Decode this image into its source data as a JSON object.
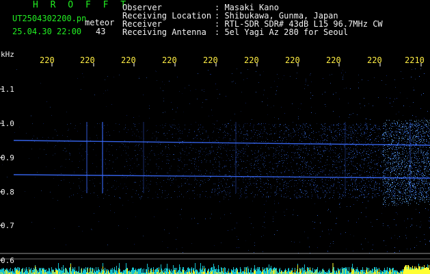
{
  "header": {
    "brand": "H R O F F T",
    "filename": "UT2504302200.pn",
    "mode": "meteor",
    "datetime": "25.04.30 22:00",
    "count": "43",
    "fields": [
      {
        "label": "Observer",
        "value": ": Masaki Kano"
      },
      {
        "label": "Receiving Location",
        "value": ": Shibukawa, Gunma, Japan"
      },
      {
        "label": "Receiver",
        "value": ": RTL-SDR SDR# 43dB L15 96.7MHz CW"
      },
      {
        "label": "Receiving Antenna",
        "value": ": 5el Yagi Az 280 for Seoul"
      }
    ]
  },
  "axis": {
    "y_unit": "kHz",
    "y_ticks": [
      "1.1",
      "1.0",
      "0.9",
      "0.8",
      "0.7",
      "0.6"
    ],
    "time_ticks": [
      "220",
      "220",
      "220",
      "220",
      "220",
      "220",
      "220",
      "220",
      "220",
      "2210"
    ]
  },
  "colors": {
    "header_green": "#22ee22",
    "header_white": "#f2f2f2",
    "tick_yellow": "#ffee44",
    "signal_blue": "#3a6cff",
    "background": "#000000"
  }
}
